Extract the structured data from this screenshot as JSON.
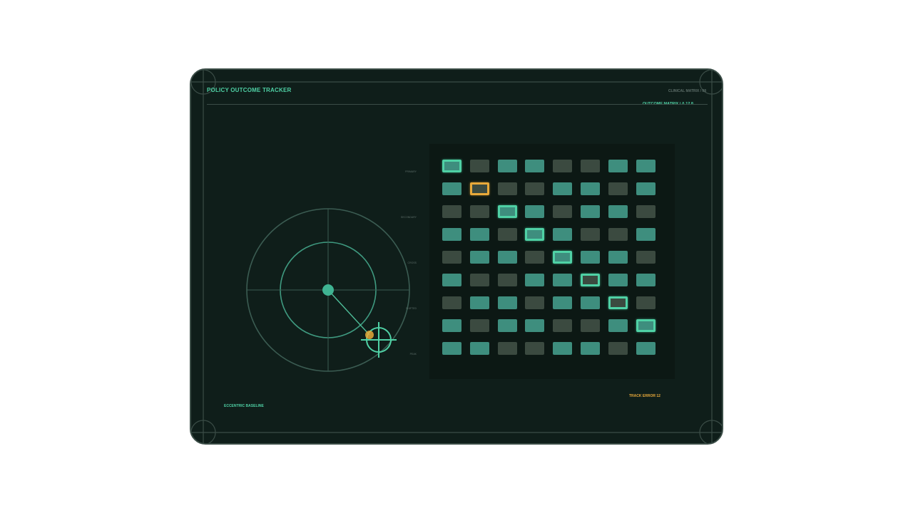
{
  "header": {
    "title": "POLICY OUTCOME TRACKER",
    "subtitle": "CLINICAL MATRIX / 08",
    "matrix_label": "OUTCOME MATRIX / Δ 12.8"
  },
  "polar": {
    "axis_labels": [
      "PRIMARY",
      "SECONDARY",
      "CROSS",
      "SHIFTED",
      "PEAK"
    ],
    "baseline_label": "ECCENTRIC BASELINE",
    "track_error": "TRACK ERROR 12"
  },
  "matrix": {
    "rows": [
      [
        1,
        0,
        1,
        1,
        0,
        0,
        1,
        1
      ],
      [
        1,
        0,
        0,
        0,
        1,
        1,
        0,
        1
      ],
      [
        0,
        0,
        1,
        1,
        0,
        1,
        1,
        0
      ],
      [
        1,
        1,
        0,
        1,
        1,
        0,
        0,
        1
      ],
      [
        0,
        1,
        1,
        0,
        1,
        1,
        1,
        0
      ],
      [
        1,
        0,
        0,
        1,
        1,
        0,
        1,
        1
      ],
      [
        0,
        1,
        1,
        0,
        1,
        1,
        0,
        0
      ],
      [
        1,
        0,
        1,
        1,
        0,
        0,
        1,
        1
      ],
      [
        1,
        1,
        0,
        0,
        1,
        1,
        0,
        1
      ]
    ],
    "selected": [
      {
        "row": 0,
        "col": 0,
        "state": "ok"
      },
      {
        "row": 1,
        "col": 1,
        "state": "warn"
      },
      {
        "row": 2,
        "col": 2,
        "state": "ok"
      },
      {
        "row": 3,
        "col": 3,
        "state": "ok"
      },
      {
        "row": 4,
        "col": 4,
        "state": "ok"
      },
      {
        "row": 5,
        "col": 5,
        "state": "ok"
      },
      {
        "row": 6,
        "col": 6,
        "state": "ok"
      },
      {
        "row": 7,
        "col": 7,
        "state": "ok"
      }
    ]
  },
  "colors": {
    "accent": "#4fd1a5",
    "warning": "#e8a93a",
    "panel_bg": "#0f1e1a",
    "cell_on": "#3e8e7e",
    "cell_off": "#3b4a40"
  }
}
